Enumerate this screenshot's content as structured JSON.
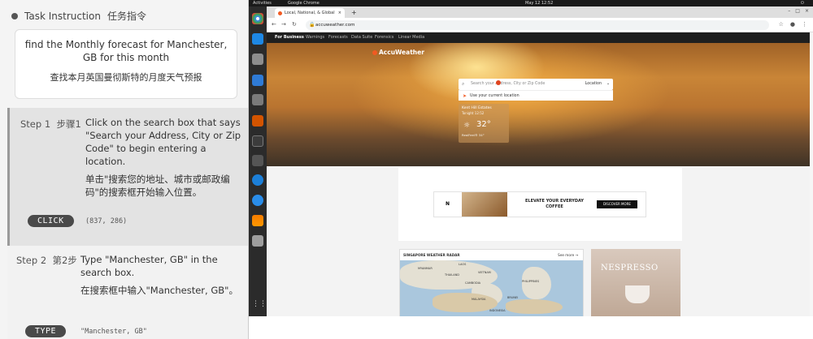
{
  "task": {
    "header": "Task Instruction",
    "header_zh": "任务指令",
    "instruction_en": "find the Monthly forecast for Manchester, GB for this month",
    "instruction_zh": "查找本月英国曼彻斯特的月度天气预报"
  },
  "steps": [
    {
      "label": "Step 1",
      "label_zh": "步骤1",
      "text_en": "Click on the search box that says \"Search your Address, City or Zip Code\" to begin entering a location.",
      "text_zh": "单击\"搜索您的地址、城市或邮政编码\"的搜索框开始输入位置。",
      "action": "CLICK",
      "params": "(837, 286)"
    },
    {
      "label": "Step 2",
      "label_zh": "第2步",
      "text_en": "Type \"Manchester, GB\" in the search box.",
      "text_zh": "在搜索框中输入\"Manchester, GB\"。",
      "action": "TYPE",
      "params": "\"Manchester, GB\""
    }
  ],
  "desktop": {
    "activities": "Activities",
    "app": "Google Chrome",
    "clock": "May 12  12:52"
  },
  "browser": {
    "tab_title": "Local, National, & Global",
    "url": "accuweather.com"
  },
  "site": {
    "nav": [
      "For Business",
      "Warnings",
      "Forecasts",
      "Data Suite",
      "Forensics",
      "Linear Media"
    ],
    "logo": "AccuWeather",
    "search_placeholder": "Search your Address, City or Zip Code",
    "location_label": "Location",
    "use_location": "Use your current location",
    "weather_card": {
      "city": "Kent Hill Estates",
      "time": "Tonight 12:52",
      "temp": "32°",
      "realfeel": "RealFeel® 34°"
    },
    "ad": {
      "brand": "N",
      "headline": "ELEVATE YOUR EVERYDAY COFFEE",
      "button": "DISCOVER MORE"
    },
    "radar": {
      "title": "SINGAPORE WEATHER RADAR",
      "see_more": "See more",
      "labels": [
        "MYANMAR",
        "LAOS",
        "THAILAND",
        "VIETNAM",
        "CAMBODIA",
        "PHILIPPINES",
        "MALAYSIA",
        "BRUNEI",
        "INDONESIA"
      ]
    },
    "nespresso": "NESPRESSO"
  },
  "colors": {
    "accent": "#f15a22",
    "step_active": "#e3e3e3",
    "badge": "#4a4a4a"
  }
}
